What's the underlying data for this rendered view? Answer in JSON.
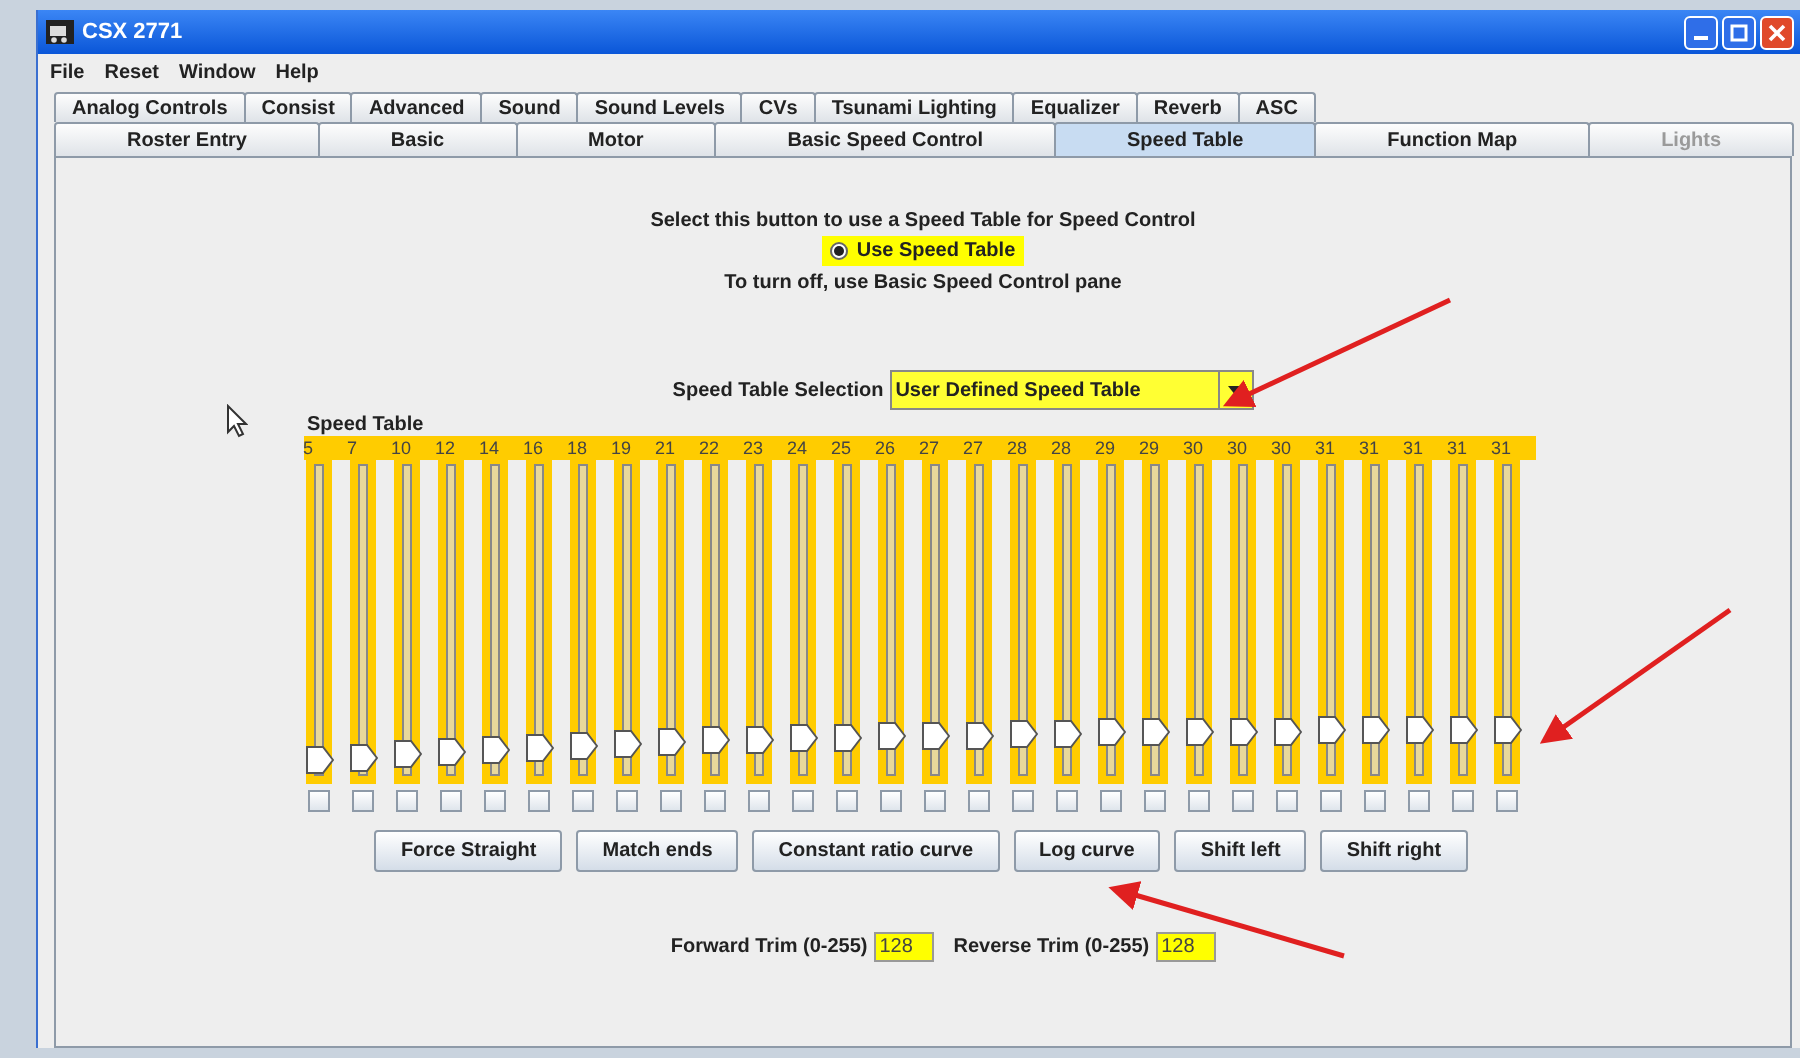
{
  "window": {
    "title": "CSX 2771"
  },
  "menu": [
    "File",
    "Reset",
    "Window",
    "Help"
  ],
  "tabs_row_1": [
    {
      "label": "Analog Controls",
      "selected": false
    },
    {
      "label": "Consist",
      "selected": false
    },
    {
      "label": "Advanced",
      "selected": false
    },
    {
      "label": "Sound",
      "selected": false
    },
    {
      "label": "Sound Levels",
      "selected": false
    },
    {
      "label": "CVs",
      "selected": false
    },
    {
      "label": "Tsunami Lighting",
      "selected": false
    },
    {
      "label": "Equalizer",
      "selected": false
    },
    {
      "label": "Reverb",
      "selected": false
    },
    {
      "label": "ASC",
      "selected": false
    }
  ],
  "tabs_row_2": [
    {
      "label": "Roster Entry",
      "selected": false,
      "disabled": false
    },
    {
      "label": "Basic",
      "selected": false,
      "disabled": false
    },
    {
      "label": "Motor",
      "selected": false,
      "disabled": false
    },
    {
      "label": "Basic Speed Control",
      "selected": false,
      "disabled": false
    },
    {
      "label": "Speed Table",
      "selected": true,
      "disabled": false
    },
    {
      "label": "Function Map",
      "selected": false,
      "disabled": false
    },
    {
      "label": "Lights",
      "selected": false,
      "disabled": true
    }
  ],
  "speed_table": {
    "prompt": "Select this button to use a Speed Table for Speed Control",
    "radio": {
      "label": "Use Speed Table",
      "selected": true
    },
    "note": "To turn off, use Basic Speed Control pane",
    "selection": {
      "label": "Speed Table Selection",
      "value": "User Defined Speed Table"
    },
    "title": "Speed Table",
    "steps": [
      {
        "value": "5",
        "level": 0.02,
        "checked": false
      },
      {
        "value": "7",
        "level": 0.027,
        "checked": false
      },
      {
        "value": "10",
        "level": 0.039,
        "checked": false
      },
      {
        "value": "12",
        "level": 0.047,
        "checked": false
      },
      {
        "value": "14",
        "level": 0.055,
        "checked": false
      },
      {
        "value": "16",
        "level": 0.063,
        "checked": false
      },
      {
        "value": "18",
        "level": 0.071,
        "checked": false
      },
      {
        "value": "19",
        "level": 0.075,
        "checked": false
      },
      {
        "value": "21",
        "level": 0.082,
        "checked": false
      },
      {
        "value": "22",
        "level": 0.086,
        "checked": false
      },
      {
        "value": "23",
        "level": 0.09,
        "checked": false
      },
      {
        "value": "24",
        "level": 0.094,
        "checked": false
      },
      {
        "value": "25",
        "level": 0.098,
        "checked": false
      },
      {
        "value": "26",
        "level": 0.102,
        "checked": false
      },
      {
        "value": "27",
        "level": 0.106,
        "checked": false
      },
      {
        "value": "27",
        "level": 0.106,
        "checked": false
      },
      {
        "value": "28",
        "level": 0.11,
        "checked": false
      },
      {
        "value": "28",
        "level": 0.11,
        "checked": false
      },
      {
        "value": "29",
        "level": 0.114,
        "checked": false
      },
      {
        "value": "29",
        "level": 0.114,
        "checked": false
      },
      {
        "value": "30",
        "level": 0.118,
        "checked": false
      },
      {
        "value": "30",
        "level": 0.118,
        "checked": false
      },
      {
        "value": "30",
        "level": 0.118,
        "checked": false
      },
      {
        "value": "31",
        "level": 0.122,
        "checked": false
      },
      {
        "value": "31",
        "level": 0.122,
        "checked": false
      },
      {
        "value": "31",
        "level": 0.122,
        "checked": false
      },
      {
        "value": "31",
        "level": 0.122,
        "checked": false
      },
      {
        "value": "31",
        "level": 0.122,
        "checked": false
      }
    ],
    "buttons": [
      "Force Straight",
      "Match ends",
      "Constant ratio curve",
      "Log curve",
      "Shift left",
      "Shift right"
    ],
    "forward_trim": {
      "label": "Forward Trim (0-255)",
      "value": "128"
    },
    "reverse_trim": {
      "label": "Reverse Trim (0-255)",
      "value": "128"
    }
  }
}
